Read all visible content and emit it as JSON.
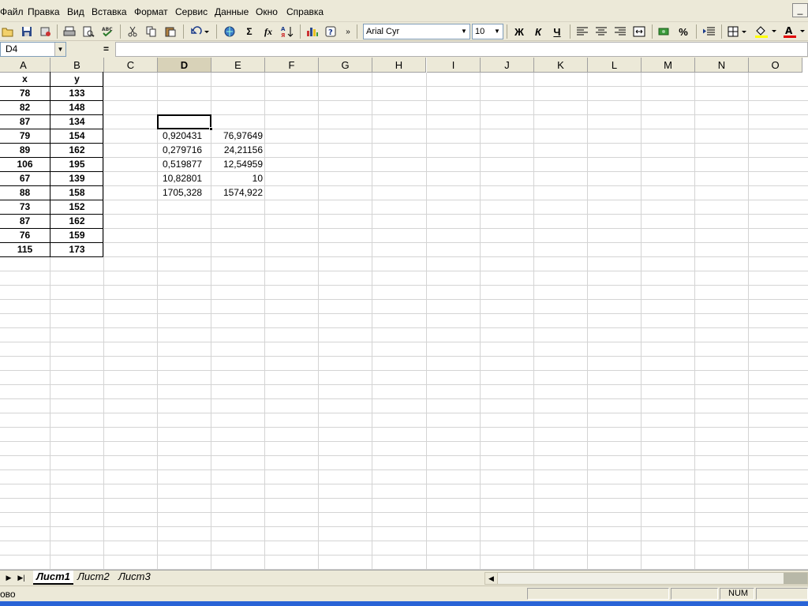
{
  "menu": [
    "Файл",
    "Правка",
    "Вид",
    "Вставка",
    "Формат",
    "Сервис",
    "Данные",
    "Окно",
    "Справка"
  ],
  "toolbar": {
    "font_name": "Arial Cyr",
    "font_size": "10",
    "bold_label": "Ж",
    "italic_label": "К",
    "underline_label": "Ч",
    "sum_label": "Σ",
    "fx_label": "fx",
    "percent_label": "%",
    "font_color_label": "A"
  },
  "formula_bar": {
    "name_box": "D4",
    "equals": "=",
    "content": ""
  },
  "sheet": {
    "columns": [
      "A",
      "B",
      "C",
      "D",
      "E",
      "F",
      "G",
      "H",
      "I",
      "J",
      "K",
      "L",
      "M",
      "N",
      "O"
    ],
    "selected_column": "D",
    "table_header": [
      "x",
      "y"
    ],
    "table_rows": [
      [
        "78",
        "133"
      ],
      [
        "82",
        "148"
      ],
      [
        "87",
        "134"
      ],
      [
        "79",
        "154"
      ],
      [
        "89",
        "162"
      ],
      [
        "106",
        "195"
      ],
      [
        "67",
        "139"
      ],
      [
        "88",
        "158"
      ],
      [
        "73",
        "152"
      ],
      [
        "87",
        "162"
      ],
      [
        "76",
        "159"
      ],
      [
        "115",
        "173"
      ]
    ],
    "stats_rows": [
      [
        "0,920431",
        "76,97649"
      ],
      [
        "0,279716",
        "24,21156"
      ],
      [
        "0,519877",
        "12,54959"
      ],
      [
        "10,82801",
        "10"
      ],
      [
        "1705,328",
        "1574,922"
      ]
    ]
  },
  "tabs": [
    "Лист1",
    "Лист2",
    "Лист3"
  ],
  "active_tab": "Лист1",
  "status": {
    "text": "ово",
    "num": "NUM"
  },
  "colors": {
    "chrome": "#ece9d8",
    "grid_line": "#d4d4d4",
    "taskbar": "#2a64d6"
  }
}
